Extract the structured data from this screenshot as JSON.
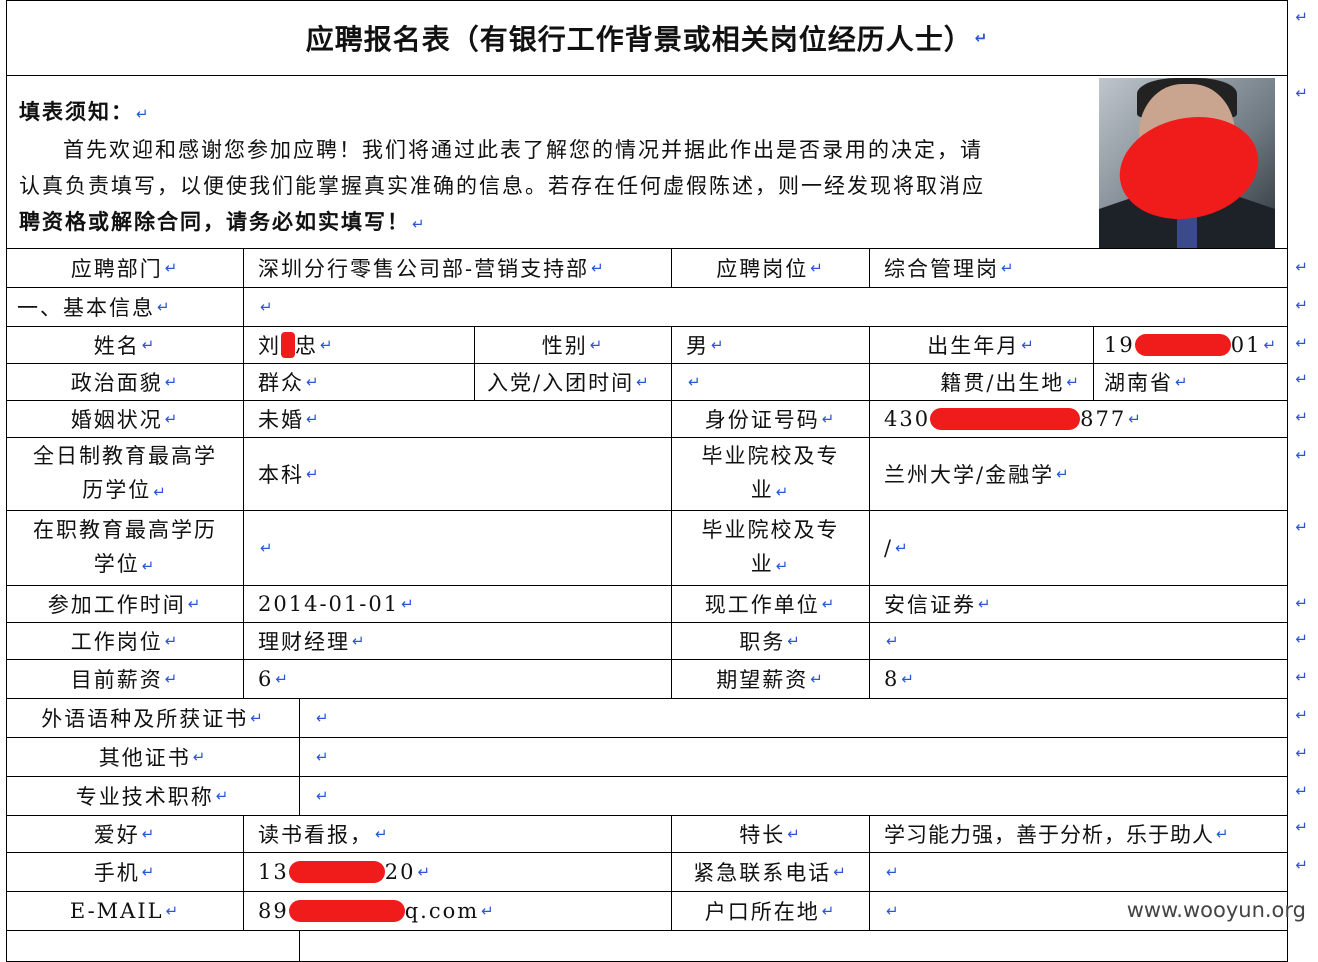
{
  "title": "应聘报名表（有银行工作背景或相关岗位经历人士）",
  "notice": {
    "heading": "填表须知：",
    "line1": "首先欢迎和感谢您参加应聘！我们将通过此表了解您的情况并据此作出是否录用的决定，请",
    "line2": "认真负责填写，以便使我们能掌握真实准确的信息。若存在任何虚假陈述，则一经发现将取消应",
    "line3": "聘资格或解除合同，请务必如实填写！"
  },
  "mark": "↵",
  "rows": {
    "dept_label": "应聘部门",
    "dept_value": "深圳分行零售公司部-营销支持部",
    "post_label": "应聘岗位",
    "post_value": "综合管理岗",
    "section1": "一、基本信息",
    "name_label": "姓名",
    "name_first": "刘",
    "name_last": "忠",
    "gender_label": "性别",
    "gender_value": "男",
    "birth_label": "出生年月",
    "birth_prefix": "19",
    "birth_suffix": "01",
    "politics_label": "政治面貌",
    "politics_value": "群众",
    "party_label": "入党/入团时间",
    "origin_label": "籍贯/出生地",
    "origin_value": "湖南省",
    "marital_label": "婚姻状况",
    "marital_value": "未婚",
    "id_label": "身份证号码",
    "id_prefix": "430",
    "id_suffix": "877",
    "edu_label_a": "全日制教育最高学",
    "edu_label_b": "历学位",
    "edu_value": "本科",
    "school_label_a": "毕业院校及专",
    "school_label_b": "业",
    "school_value": "兰州大学/金融学",
    "edu2_label_a": "在职教育最高学历",
    "edu2_label_b": "学位",
    "school2_label_a": "毕业院校及专",
    "school2_label_b": "业",
    "school2_value": "/",
    "work_start_label": "参加工作时间",
    "work_start_value": "2014-01-01",
    "employer_label": "现工作单位",
    "employer_value": "安信证券",
    "job_label": "工作岗位",
    "job_value": "理财经理",
    "title_label": "职务",
    "salary_label": "目前薪资",
    "salary_value": "6",
    "expect_label": "期望薪资",
    "expect_value": "8",
    "lang_label": "外语语种及所获证书",
    "cert_label": "其他证书",
    "prof_label": "专业技术职称",
    "hobby_label": "爱好",
    "hobby_value": "读书看报，",
    "skill_label": "特长",
    "skill_value": "学习能力强，善于分析，乐于助人",
    "phone_label": "手机",
    "phone_prefix": "13",
    "phone_suffix": "20",
    "emergency_label": "紧急联系电话",
    "email_label": "E-MAIL",
    "email_prefix": "89",
    "email_suffix": "q.com",
    "hukou_label": "户口所在地"
  },
  "watermark": "www.wooyun.org"
}
